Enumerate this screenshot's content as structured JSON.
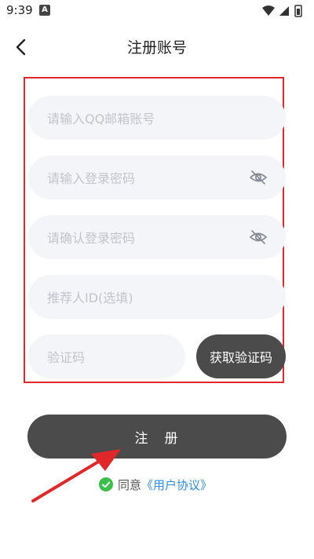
{
  "status_bar": {
    "time": "9:39",
    "notification_badge": "A"
  },
  "header": {
    "title": "注册账号"
  },
  "form": {
    "email_placeholder": "请输入QQ邮箱账号",
    "password_placeholder": "请输入登录密码",
    "confirm_password_placeholder": "请确认登录密码",
    "referrer_placeholder": "推荐人ID(选填)",
    "code_placeholder": "验证码",
    "get_code_label": "获取验证码"
  },
  "register_button_label": "注　册",
  "agreement": {
    "prefix": "同意",
    "link_text": "《用户协议》"
  },
  "colors": {
    "button_bg": "#4b4b4b",
    "field_bg": "#f4f5f9",
    "highlight_border": "#e0282b",
    "link": "#2b8ef0",
    "check": "#3cbf4a"
  }
}
